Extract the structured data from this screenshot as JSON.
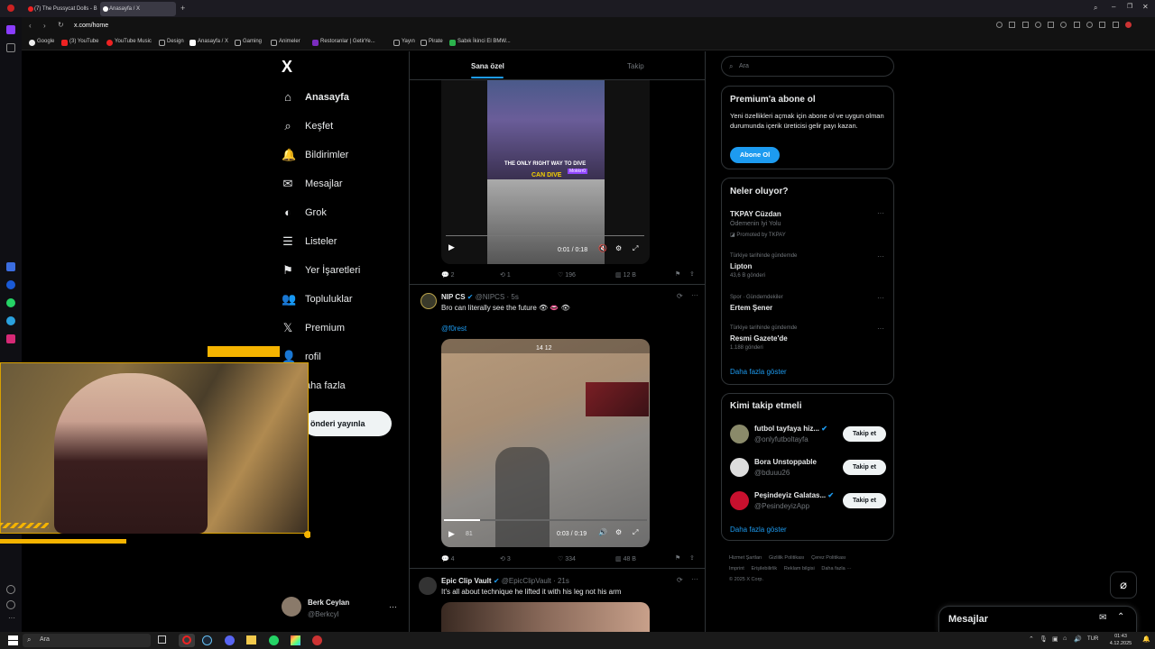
{
  "browser": {
    "tabs": [
      {
        "title": "(7) The Pussycat Dolls - B",
        "active": false
      },
      {
        "title": "Anasayfa / X",
        "active": true
      }
    ],
    "url": "x.com/home",
    "bookmarks": [
      "Google",
      "(3) YouTube",
      "YouTube Music",
      "Design",
      "Anasayfa / X",
      "Gaming",
      "Animeler",
      "Restoranlar | GetirYe...",
      "Yayın",
      "Pirate",
      "Sabık İkinci El BMW..."
    ]
  },
  "nav": {
    "logo": "X",
    "items": [
      {
        "label": "Anasayfa",
        "icon": "home-icon"
      },
      {
        "label": "Keşfet",
        "icon": "search-icon"
      },
      {
        "label": "Bildirimler",
        "icon": "bell-icon"
      },
      {
        "label": "Mesajlar",
        "icon": "mail-icon"
      },
      {
        "label": "Grok",
        "icon": "grok-icon"
      },
      {
        "label": "Listeler",
        "icon": "list-icon"
      },
      {
        "label": "Yer İşaretleri",
        "icon": "bookmark-icon"
      },
      {
        "label": "Topluluklar",
        "icon": "people-icon"
      },
      {
        "label": "Premium",
        "icon": "x-icon"
      },
      {
        "label": "rofil",
        "icon": "profile-icon"
      },
      {
        "label": "aha fazla",
        "icon": "more-icon"
      }
    ],
    "post_button": "önderi yayınla",
    "user": {
      "name": "Berk Ceylan",
      "handle": "@Berkcyl"
    }
  },
  "feed": {
    "tabs": [
      "Sana özel",
      "Takip"
    ],
    "tweet1": {
      "video_text1": "THE ONLY RIGHT WAY TO DIVE",
      "video_text2": "CAN DIVE",
      "video_tag": "Mokkrr0",
      "time": "0:01 / 0:18",
      "replies": "2",
      "retweets": "1",
      "likes": "196",
      "views": "12 B"
    },
    "tweet2": {
      "name": "NIP CS",
      "handle": "@NIPCS · 5s",
      "text": "Bro can literally see the future 👁 👄 👁",
      "mention": "@f0rest",
      "hud": "14 12",
      "hud_sub": "81",
      "time": "0:03 / 0:19",
      "replies": "4",
      "retweets": "3",
      "likes": "334",
      "views": "48 B"
    },
    "tweet3": {
      "name": "Epic Clip Vault",
      "handle": "@EpicClipVault · 21s",
      "text": "It's all about technique he lifted it with his leg not his arm"
    }
  },
  "right": {
    "search_placeholder": "Ara",
    "premium": {
      "title": "Premium'a abone ol",
      "text": "Yeni özellikleri açmak için abone ol ve uygun olman durumunda içerik üreticisi gelir payı kazan.",
      "button": "Abone Ol"
    },
    "trends": {
      "title": "Neler oluyor?",
      "items": [
        {
          "meta": "",
          "title": "TKPAY Cüzdan",
          "sub": "Ödemenin İyi Yolu",
          "extra": "Promoted by TKPAY"
        },
        {
          "meta": "Türkiye tarihinde gündemde",
          "title": "Lipton",
          "sub": "43,6 B gönderi",
          "extra": ""
        },
        {
          "meta": "Spor · Gündemdekiler",
          "title": "Ertem Şener",
          "sub": "",
          "extra": ""
        },
        {
          "meta": "Türkiye tarihinde gündemde",
          "title": "Resmi Gazete'de",
          "sub": "1.188 gönderi",
          "extra": ""
        }
      ],
      "more": "Daha fazla göster"
    },
    "follow": {
      "title": "Kimi takip etmeli",
      "items": [
        {
          "name": "futbol tayfaya hiz...",
          "handle": "@onlyfutboltayfa",
          "button": "Takip et"
        },
        {
          "name": "Bora Unstoppable",
          "handle": "@bduuu26",
          "button": "Takip et"
        },
        {
          "name": "Peşindeyiz Galatas...",
          "handle": "@PesindeyizApp",
          "button": "Takip et"
        }
      ],
      "more": "Daha fazla göster"
    },
    "footer": [
      "Hizmet Şartları",
      "Gizlilik Politikası",
      "Çerez Politikası",
      "Imprint",
      "Erişilebilirlik",
      "Reklam bilgisi",
      "Daha fazla ···",
      "© 2025 X Corp."
    ]
  },
  "messages_dock": {
    "title": "Mesajlar"
  },
  "taskbar": {
    "search": "Ara",
    "lang": "TUR",
    "time": "01:43",
    "date": "4.12.2025"
  }
}
